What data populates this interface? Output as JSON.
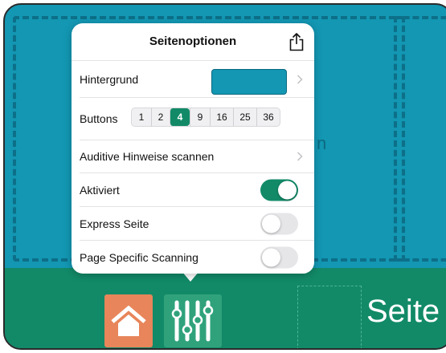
{
  "colors": {
    "board_bg": "#1397b3",
    "bottom_bar": "#128a68",
    "home_button": "#e8855a",
    "settings_button": "#2fa27c",
    "accent": "#128a68",
    "swatch": "#1397b3"
  },
  "background": {
    "partial_text": "n",
    "page_label": "Seite"
  },
  "bottombar": {
    "home_icon": "home-icon",
    "settings_icon": "sliders-icon"
  },
  "popover": {
    "title": "Seitenoptionen",
    "share_icon": "share-icon",
    "rows": {
      "background": {
        "label": "Hintergrund",
        "swatch_color": "#1397b3"
      },
      "buttons": {
        "label": "Buttons",
        "options": [
          "1",
          "2",
          "4",
          "9",
          "16",
          "25",
          "36"
        ],
        "selected": "4"
      },
      "audio": {
        "label": "Auditive Hinweise scannen"
      },
      "activated": {
        "label": "Aktiviert",
        "value": true
      },
      "express": {
        "label": "Express Seite",
        "value": false
      },
      "page_scanning": {
        "label": "Page Specific Scanning",
        "value": false
      }
    }
  }
}
